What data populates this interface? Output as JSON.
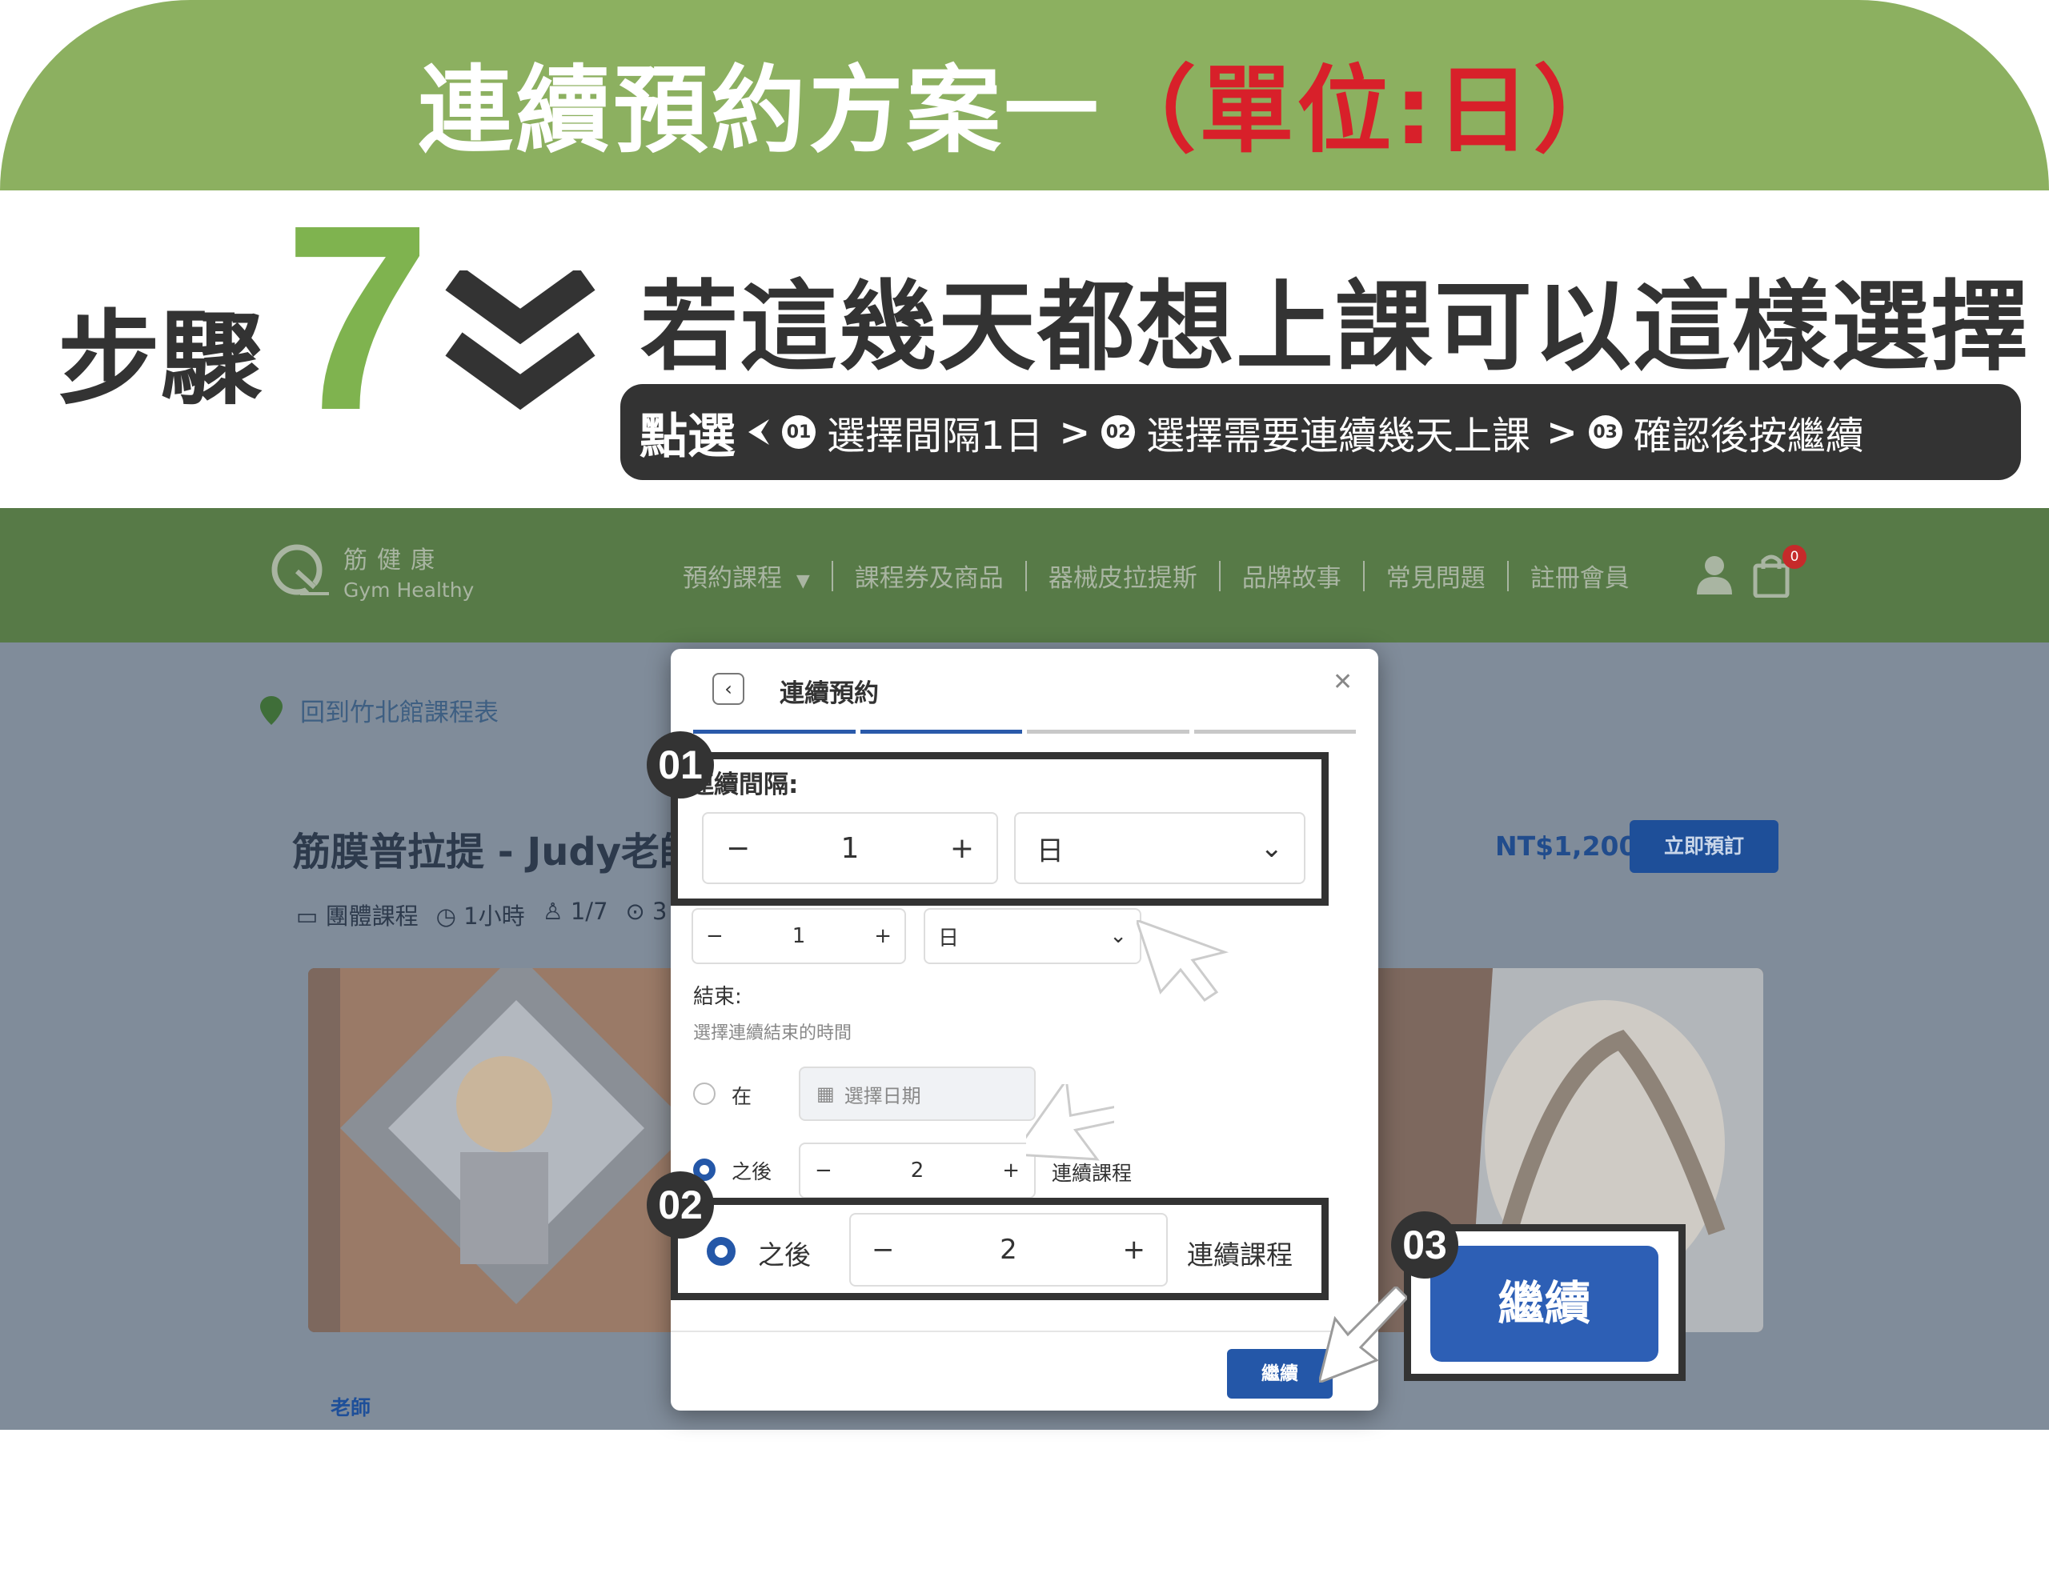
{
  "banner": {
    "title_main": "連續預約方案一",
    "title_unit": "（單位:日）"
  },
  "step": {
    "label": "步驟",
    "number": "7"
  },
  "headline": "若這幾天都想上課可以這樣選擇",
  "instruction": {
    "lead": "點選",
    "badges": [
      "01",
      "02",
      "03"
    ],
    "steps": [
      "選擇間隔1日",
      "選擇需要連續幾天上課",
      "確認後按繼續"
    ]
  },
  "site": {
    "logo_cn": "筋健康",
    "logo_en": "Gym Healthy",
    "menu": [
      "預約課程",
      "課程券及商品",
      "器械皮拉提斯",
      "品牌故事",
      "常見問題",
      "註冊會員"
    ],
    "cart_count": "0",
    "back_link": "回到竹北館課程表",
    "course_title": "筋膜普拉提 - Judy老師",
    "meta": [
      "團體課程",
      "1小時",
      "1/7",
      "3"
    ],
    "price": "NT$1,200",
    "book_now": "立即預訂",
    "teacher_label": "老師"
  },
  "modal": {
    "title": "連續預約",
    "interval_label": "連續間隔:",
    "interval_value": "1",
    "interval_unit": "日",
    "end_label": "結束:",
    "end_sub": "選擇連續結束的時間",
    "on_label": "在",
    "date_placeholder": "選擇日期",
    "after_label": "之後",
    "after_value": "2",
    "after_suffix": "連續課程",
    "continue": "繼續"
  },
  "callouts": {
    "n1": "01",
    "n2": "02",
    "n3": "03",
    "big_continue": "繼續"
  }
}
